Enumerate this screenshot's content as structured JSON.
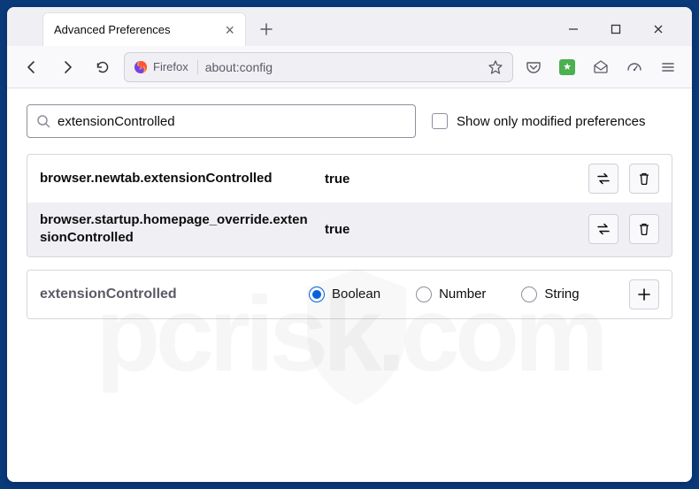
{
  "tab": {
    "title": "Advanced Preferences"
  },
  "addressbar": {
    "brand": "Firefox",
    "url": "about:config"
  },
  "search": {
    "value": "extensionControlled",
    "modified_label": "Show only modified preferences"
  },
  "prefs": [
    {
      "name": "browser.newtab.extensionControlled",
      "value": "true"
    },
    {
      "name": "browser.startup.homepage_override.extensionControlled",
      "value": "true"
    }
  ],
  "addpref": {
    "name": "extensionControlled",
    "types": {
      "boolean": "Boolean",
      "number": "Number",
      "string": "String"
    }
  }
}
